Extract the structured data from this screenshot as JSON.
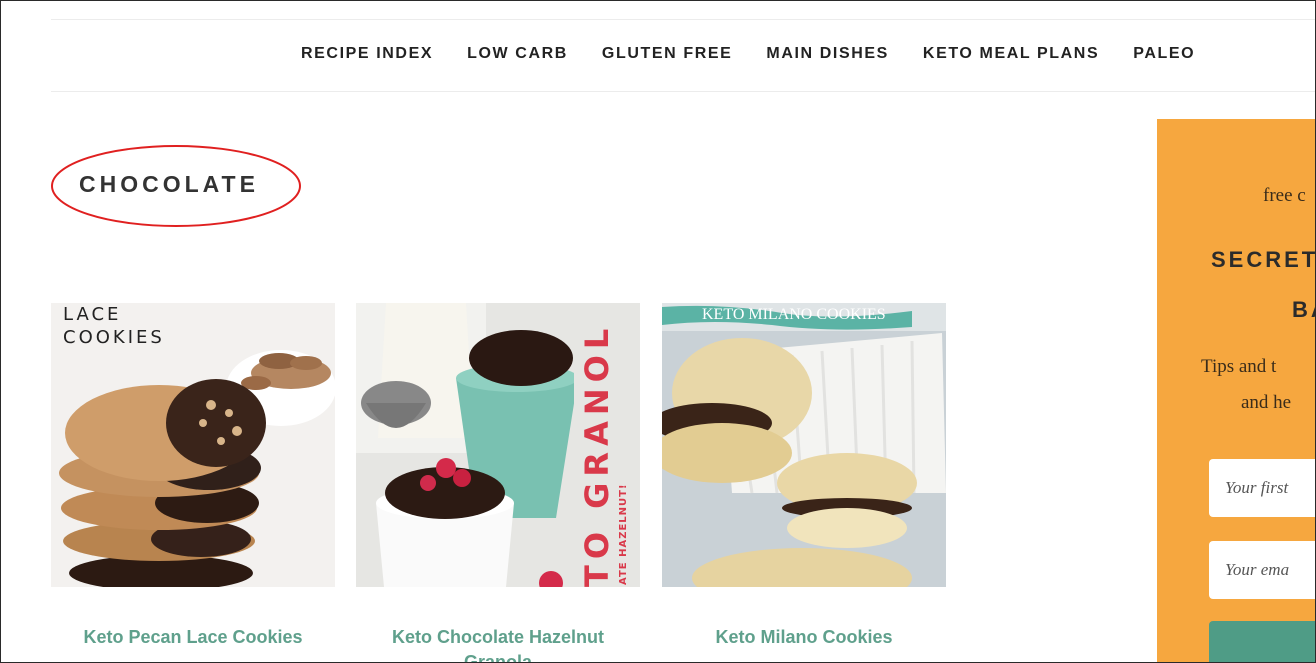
{
  "nav": {
    "items": [
      "RECIPE INDEX",
      "LOW CARB",
      "GLUTEN FREE",
      "MAIN DISHES",
      "KETO MEAL PLANS",
      "PALEO"
    ]
  },
  "category": {
    "title": "CHOCOLATE"
  },
  "posts": [
    {
      "title": "Keto Pecan Lace Cookies",
      "image_text": "LACE COOKIES"
    },
    {
      "title": "Keto Chocolate Hazelnut Granola",
      "image_text": "TO GRANOL",
      "image_subtext": "ATE HAZELNUT!"
    },
    {
      "title": "Keto Milano Cookies",
      "image_text": "KETO MILANO COOKIES"
    }
  ],
  "sidebar": {
    "intro": "free c",
    "heading_line1": "SECRET",
    "heading_line2": "BA",
    "body_line1": "Tips and t",
    "body_line2": "and he",
    "first_name_placeholder": "Your first",
    "email_placeholder": "Your ema"
  },
  "colors": {
    "link": "#5fa08c",
    "sidebar_bg": "#f6a73f",
    "button": "#4f9c86",
    "annotation": "#e02020"
  }
}
